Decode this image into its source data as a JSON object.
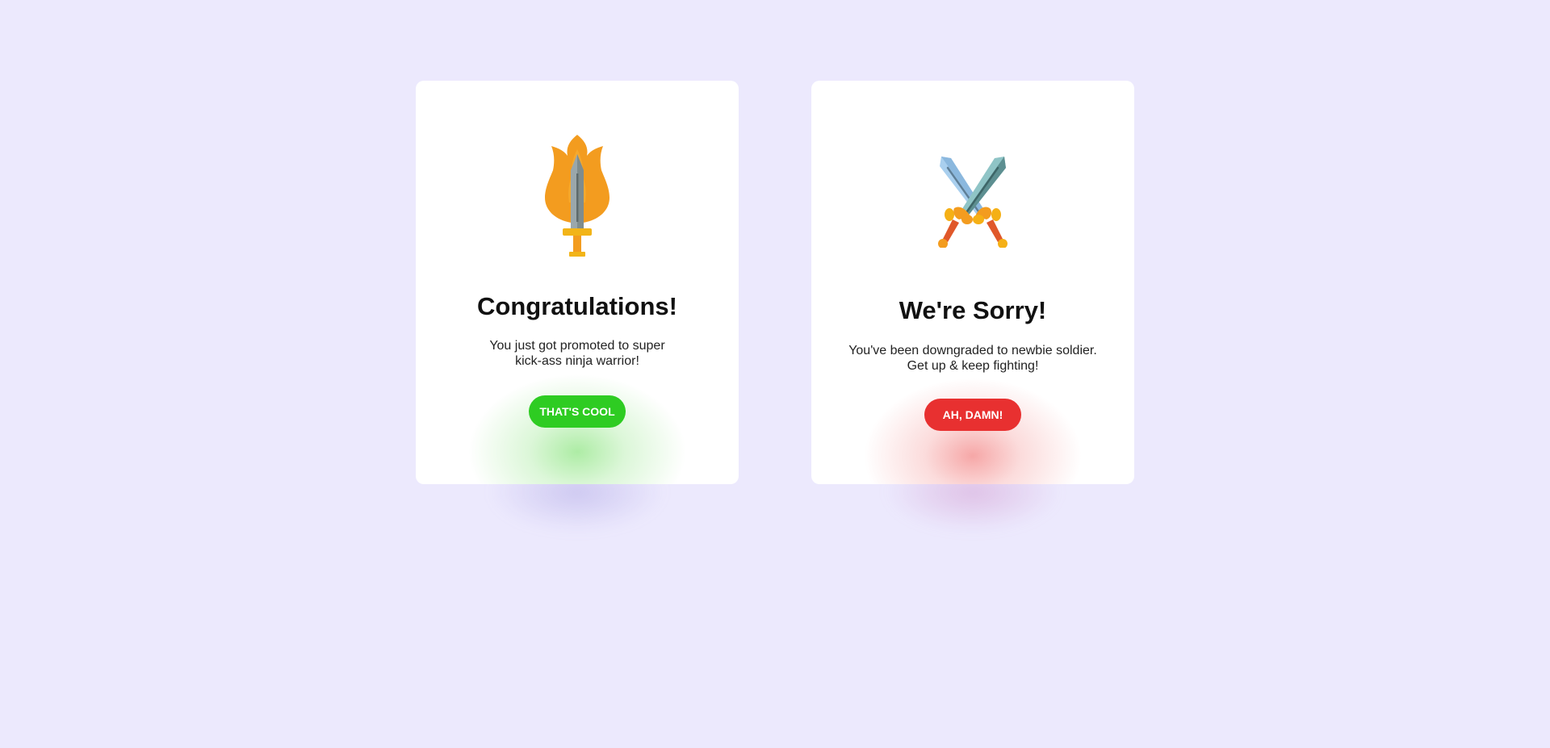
{
  "cards": {
    "success": {
      "icon": "flaming-sword-icon",
      "title": "Congratulations!",
      "message": "You just got promoted to super kick-ass ninja warrior!",
      "button_label": "THAT'S COOL",
      "accent_color": "#2ecc22"
    },
    "error": {
      "icon": "crossed-swords-icon",
      "title": "We're Sorry!",
      "message": "You've been downgraded to newbie soldier. Get up & keep fighting!",
      "button_label": "AH, DAMN!",
      "accent_color": "#e83030"
    }
  },
  "colors": {
    "background": "#ece9fd",
    "card": "#ffffff"
  }
}
